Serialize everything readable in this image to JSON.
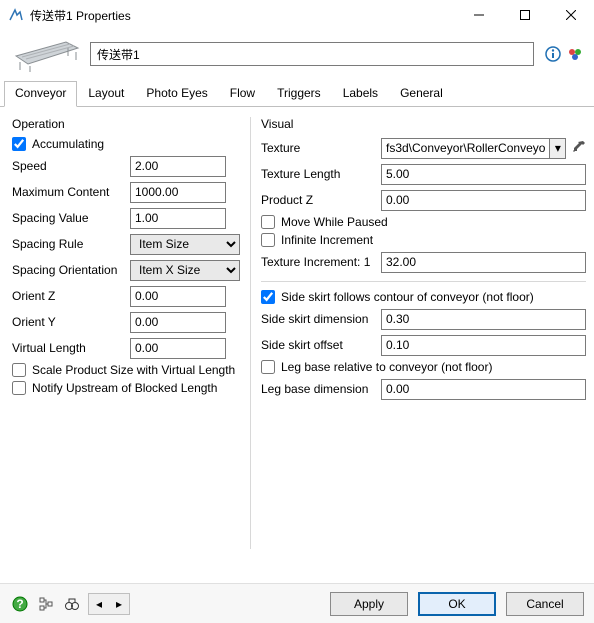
{
  "window": {
    "title": "传送带1  Properties"
  },
  "header": {
    "name_value": "传送带1"
  },
  "tabs": [
    "Conveyor",
    "Layout",
    "Photo Eyes",
    "Flow",
    "Triggers",
    "Labels",
    "General"
  ],
  "active_tab": 0,
  "operation": {
    "title": "Operation",
    "accumulating_label": "Accumulating",
    "accumulating": true,
    "speed_label": "Speed",
    "speed": "2.00",
    "maxcontent_label": "Maximum Content",
    "maxcontent": "1000.00",
    "spacingvalue_label": "Spacing Value",
    "spacingvalue": "1.00",
    "spacingrule_label": "Spacing Rule",
    "spacingrule": "Item Size",
    "spacingorient_label": "Spacing Orientation",
    "spacingorient": "Item X Size",
    "orientz_label": "Orient Z",
    "orientz": "0.00",
    "orienty_label": "Orient Y",
    "orienty": "0.00",
    "virtuallen_label": "Virtual Length",
    "virtuallen": "0.00",
    "scale_label": "Scale Product Size with Virtual Length",
    "scale": false,
    "notify_label": "Notify Upstream of Blocked Length",
    "notify": false
  },
  "visual": {
    "title": "Visual",
    "texture_label": "Texture",
    "texture": "fs3d\\Conveyor\\RollerConveyo",
    "texlen_label": "Texture Length",
    "texlen": "5.00",
    "prodz_label": "Product Z",
    "prodz": "0.00",
    "movepaused_label": "Move While Paused",
    "movepaused": false,
    "infincr_label": "Infinite Increment",
    "infincr": false,
    "texincr_label": "Texture Increment: 1",
    "texincr": "32.00",
    "sideskirt_label": "Side skirt follows contour of conveyor (not floor)",
    "sideskirt": true,
    "skirtdim_label": "Side skirt dimension",
    "skirtdim": "0.30",
    "skirtoff_label": "Side skirt offset",
    "skirtoff": "0.10",
    "legrel_label": "Leg base relative to conveyor (not floor)",
    "legrel": false,
    "legdim_label": "Leg base dimension",
    "legdim": "0.00"
  },
  "footer": {
    "apply": "Apply",
    "ok": "OK",
    "cancel": "Cancel"
  }
}
